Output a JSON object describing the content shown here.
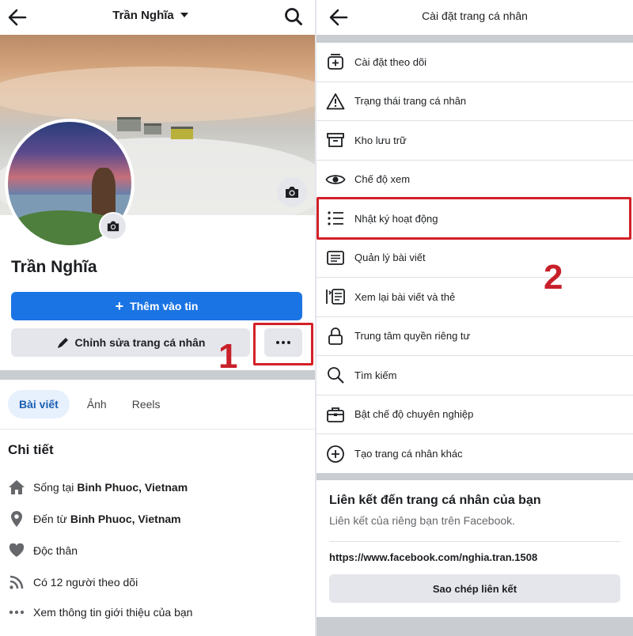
{
  "left": {
    "header": {
      "title": "Trần Nghĩa"
    },
    "profile_name": "Trần Nghĩa",
    "add_story_label": "Thêm vào tin",
    "edit_profile_label": "Chỉnh sửa trang cá nhân",
    "tabs": [
      {
        "label": "Bài viết",
        "active": true
      },
      {
        "label": "Ảnh",
        "active": false
      },
      {
        "label": "Reels",
        "active": false
      }
    ],
    "details": {
      "title": "Chi tiết",
      "lives_prefix": "Sống tại",
      "lives_place": "Binh Phuoc, Vietnam",
      "from_prefix": "Đến từ",
      "from_place": "Binh Phuoc, Vietnam",
      "relationship": "Độc thân",
      "followers": "Có 12 người theo dõi",
      "see_about": "Xem thông tin giới thiệu của bạn"
    },
    "step_number": "1"
  },
  "right": {
    "header": {
      "title": "Cài đặt trang cá nhân"
    },
    "menu": [
      {
        "label": "Cài đặt theo dõi",
        "icon": "follow-settings-icon"
      },
      {
        "label": "Trạng thái trang cá nhân",
        "icon": "warning-icon"
      },
      {
        "label": "Kho lưu trữ",
        "icon": "archive-icon"
      },
      {
        "label": "Chế độ xem",
        "icon": "eye-icon"
      },
      {
        "label": "Nhật ký hoạt động",
        "icon": "list-icon"
      },
      {
        "label": "Quản lý bài viết",
        "icon": "manage-posts-icon"
      },
      {
        "label": "Xem lại bài viết và thẻ",
        "icon": "review-posts-icon"
      },
      {
        "label": "Trung tâm quyền riêng tư",
        "icon": "lock-icon"
      },
      {
        "label": "Tìm kiếm",
        "icon": "search-icon"
      },
      {
        "label": "Bật chế độ chuyên nghiệp",
        "icon": "briefcase-icon"
      },
      {
        "label": "Tạo trang cá nhân khác",
        "icon": "plus-circle-icon"
      }
    ],
    "link_section": {
      "title": "Liên kết đến trang cá nhân của bạn",
      "subtitle": "Liên kết của riêng bạn trên Facebook.",
      "url": "https://www.facebook.com/nghia.tran.1508",
      "copy_label": "Sao chép liên kết"
    },
    "step_number": "2"
  },
  "colors": {
    "accent": "#1b74e4",
    "annotation_red": "#d32027"
  }
}
